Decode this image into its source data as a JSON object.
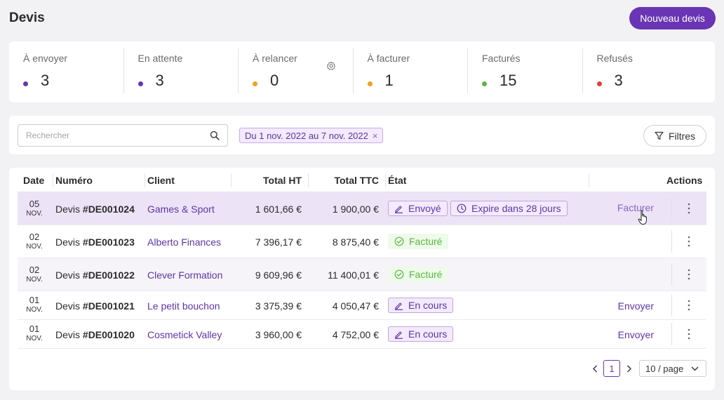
{
  "header": {
    "title": "Devis",
    "new_button": "Nouveau devis"
  },
  "stats": [
    {
      "label": "À envoyer",
      "value": "3",
      "color": "#6a35b4"
    },
    {
      "label": "En attente",
      "value": "3",
      "color": "#6a35b4"
    },
    {
      "label": "À relancer",
      "value": "0",
      "color": "#f0a020",
      "has_settings": true
    },
    {
      "label": "À facturer",
      "value": "1",
      "color": "#f0a020"
    },
    {
      "label": "Facturés",
      "value": "15",
      "color": "#5cb843"
    },
    {
      "label": "Refusés",
      "value": "3",
      "color": "#e0403a"
    }
  ],
  "filters": {
    "search_placeholder": "Rechercher",
    "date_chip": "Du 1 nov. 2022 au 7 nov. 2022",
    "chip_close": "×",
    "filters_button": "Filtres"
  },
  "table": {
    "columns": [
      "Date",
      "Numéro",
      "Client",
      "Total HT",
      "Total TTC",
      "État",
      "Actions"
    ],
    "rows": [
      {
        "day": "05",
        "month": "NOV.",
        "prefix": "Devis ",
        "number": "#DE001024",
        "client": "Games & Sport",
        "ht": "1 601,66 €",
        "ttc": "1 900,00 €",
        "status": "Envoyé",
        "status_type": "sent",
        "extra": "Expire dans 28 jours",
        "action": "Facturer"
      },
      {
        "day": "02",
        "month": "NOV.",
        "prefix": "Devis ",
        "number": "#DE001023",
        "client": "Alberto Finances",
        "ht": "7 396,17 €",
        "ttc": "8 875,40 €",
        "status": "Facturé",
        "status_type": "billed",
        "extra": "",
        "action": ""
      },
      {
        "day": "02",
        "month": "NOV.",
        "prefix": "Devis ",
        "number": "#DE001022",
        "client": "Clever Formation",
        "ht": "9 609,96 €",
        "ttc": "11 400,01 €",
        "status": "Facturé",
        "status_type": "billed",
        "extra": "",
        "action": ""
      },
      {
        "day": "01",
        "month": "NOV.",
        "prefix": "Devis ",
        "number": "#DE001021",
        "client": "Le petit bouchon",
        "ht": "3 375,39 €",
        "ttc": "4 050,47 €",
        "status": "En cours",
        "status_type": "progress",
        "extra": "",
        "action": "Envoyer"
      },
      {
        "day": "01",
        "month": "NOV.",
        "prefix": "Devis ",
        "number": "#DE001020",
        "client": "Cosmetick Valley",
        "ht": "3 960,00 €",
        "ttc": "4 752,00 €",
        "status": "En cours",
        "status_type": "progress",
        "extra": "",
        "action": "Envoyer"
      }
    ]
  },
  "pagination": {
    "current_page": "1",
    "page_size": "10 / page"
  }
}
